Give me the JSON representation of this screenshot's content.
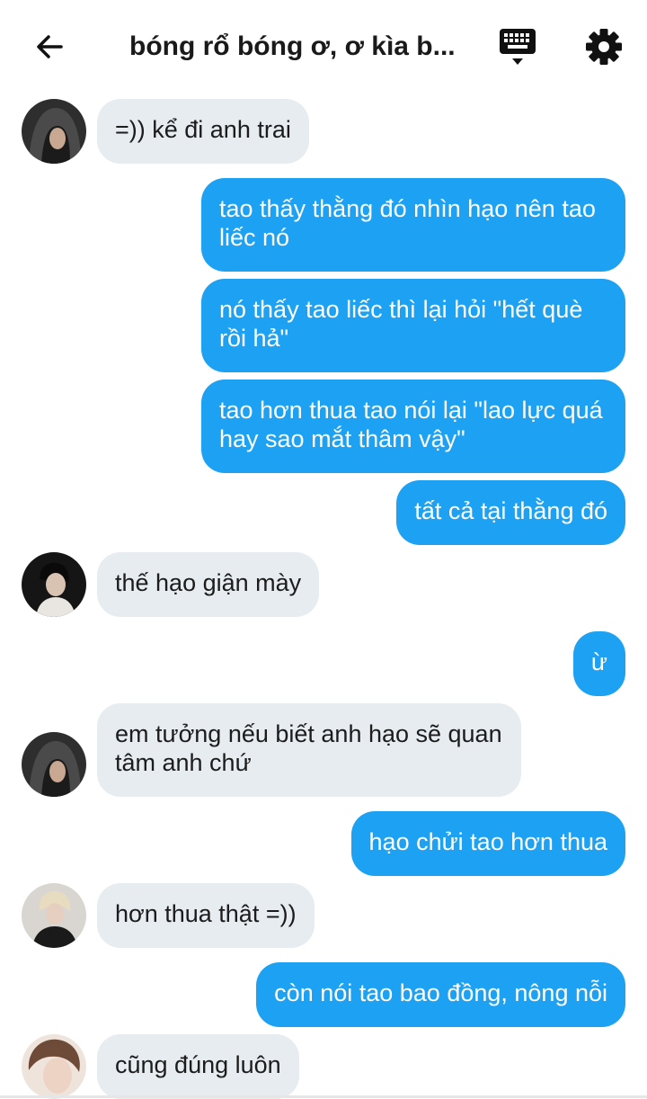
{
  "header": {
    "title": "bóng rổ bóng ơ, ơ kìa b...",
    "back_icon": "arrow-left-icon",
    "keyboard_icon": "keyboard-icon",
    "settings_icon": "gear-icon"
  },
  "colors": {
    "outgoing_bubble": "#1da1f2",
    "incoming_bubble": "#e6ecf0"
  },
  "messages": [
    {
      "side": "in",
      "avatar": "hooded-person",
      "text": "=)) kể đi anh trai"
    },
    {
      "side": "out",
      "text": "tao thấy thằng đó nhìn hạo nên tao liếc nó"
    },
    {
      "side": "out",
      "text": "nó thấy tao liếc thì lại hỏi \"hết què rồi hả\""
    },
    {
      "side": "out",
      "text": "tao hơn thua tao nói lại \"lao lực quá hay sao mắt thâm vậy\""
    },
    {
      "side": "out",
      "text": "tất cả tại thằng đó"
    },
    {
      "side": "in",
      "avatar": "dark-profile",
      "text": "thế hạo giận mày"
    },
    {
      "side": "out",
      "text": "ừ"
    },
    {
      "side": "in",
      "avatar": "hooded-person",
      "text": "em tưởng nếu biết anh hạo sẽ quan tâm anh chứ"
    },
    {
      "side": "out",
      "text": "hạo chửi tao hơn thua"
    },
    {
      "side": "in",
      "avatar": "blond-person",
      "text": "hơn thua thật =))"
    },
    {
      "side": "out",
      "text": "còn nói tao bao đồng, nông nỗi"
    },
    {
      "side": "in",
      "avatar": "brown-hair-person",
      "text": "cũng đúng luôn"
    }
  ]
}
